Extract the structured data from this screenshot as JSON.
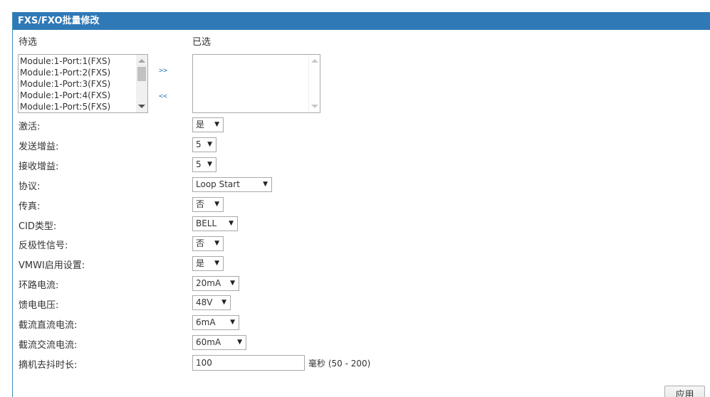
{
  "panel": {
    "title": "FXS/FXO批量修改"
  },
  "columns": {
    "available": "待选",
    "selected": "已选"
  },
  "available_options": [
    "Module:1-Port:1(FXS)",
    "Module:1-Port:2(FXS)",
    "Module:1-Port:3(FXS)",
    "Module:1-Port:4(FXS)",
    "Module:1-Port:5(FXS)"
  ],
  "selected_options": [],
  "buttons": {
    "add": ">>",
    "remove": "<<",
    "apply": "应用"
  },
  "fields": [
    {
      "label": "激活:",
      "value": "是"
    },
    {
      "label": "发送增益:",
      "value": "5"
    },
    {
      "label": "接收增益:",
      "value": "5"
    },
    {
      "label": "协议:",
      "value": "Loop Start"
    },
    {
      "label": "传真:",
      "value": "否"
    },
    {
      "label": "CID类型:",
      "value": "BELL"
    },
    {
      "label": "反极性信号:",
      "value": "否"
    },
    {
      "label": "VMWI启用设置:",
      "value": "是"
    },
    {
      "label": "环路电流:",
      "value": "20mA"
    },
    {
      "label": "馈电电压:",
      "value": "48V"
    },
    {
      "label": "截流直流电流:",
      "value": "6mA"
    },
    {
      "label": "截流交流电流:",
      "value": "60mA"
    }
  ],
  "debounce": {
    "label": "摘机去抖时长:",
    "value": "100",
    "unit": "毫秒 (50 - 200)"
  },
  "colors": {
    "header": "#2f79b7",
    "arrows": "#2f79b7"
  }
}
